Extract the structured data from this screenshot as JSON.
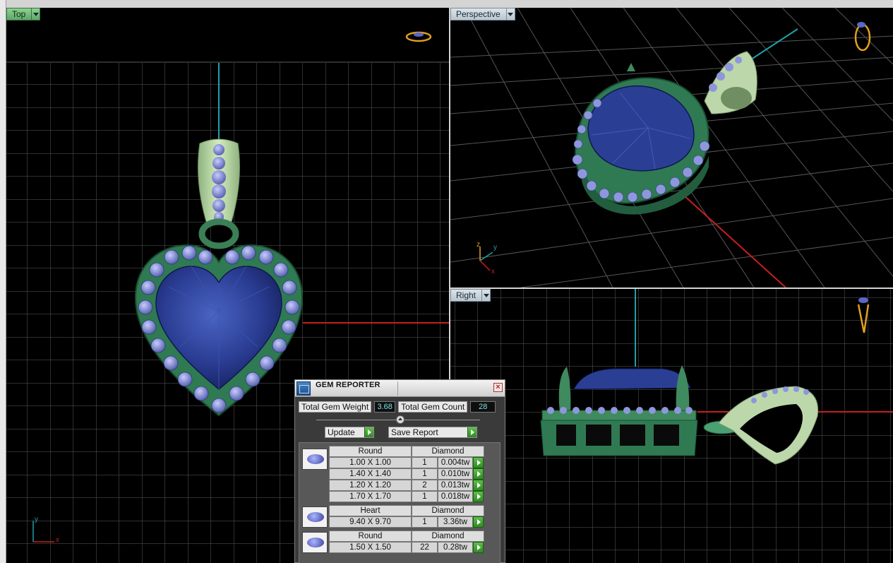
{
  "viewports": {
    "top": {
      "label": "Top"
    },
    "perspective": {
      "label": "Perspective"
    },
    "right": {
      "label": "Right"
    }
  },
  "axes": {
    "x": "x",
    "y": "y",
    "z": "z"
  },
  "gem_reporter": {
    "title": "GEM REPORTER",
    "total_weight_label": "Total Gem Weight",
    "total_weight_value": "3.68",
    "total_count_label": "Total Gem Count",
    "total_count_value": "28",
    "update_label": "Update",
    "save_report_label": "Save Report",
    "groups": [
      {
        "shape": "Round",
        "type": "Diamond",
        "rows": [
          {
            "size": "1.00 X 1.00",
            "qty": "1",
            "weight": "0.004tw"
          },
          {
            "size": "1.40 X 1.40",
            "qty": "1",
            "weight": "0.010tw"
          },
          {
            "size": "1.20 X 1.20",
            "qty": "2",
            "weight": "0.013tw"
          },
          {
            "size": "1.70 X 1.70",
            "qty": "1",
            "weight": "0.018tw"
          }
        ]
      },
      {
        "shape": "Heart",
        "type": "Diamond",
        "rows": [
          {
            "size": "9.40 X 9.70",
            "qty": "1",
            "weight": "3.36tw"
          }
        ]
      },
      {
        "shape": "Round",
        "type": "Diamond",
        "rows": [
          {
            "size": "1.50 X 1.50",
            "qty": "22",
            "weight": "0.28tw"
          }
        ]
      }
    ]
  },
  "colors": {
    "viewport_bg": "#000000",
    "grid": "#5a5a5a",
    "axis_red": "#c81e1e",
    "axis_cyan": "#1fa0a8",
    "metal_green": "#3f8a5e",
    "bail_green": "#b9d6a8",
    "sapphire": "#2a3f94",
    "accent_stones": "#8e96dc"
  }
}
